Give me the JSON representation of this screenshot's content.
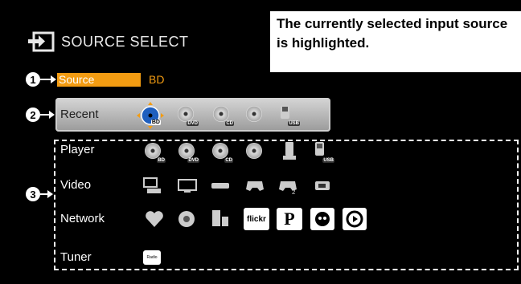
{
  "header": {
    "title": "SOURCE SELECT",
    "icon": "input-icon"
  },
  "callout": {
    "text": "The currently selected input source is highlighted."
  },
  "markers": {
    "one": "1",
    "two": "2",
    "three": "3"
  },
  "source": {
    "label": "Source",
    "value": "BD"
  },
  "recent": {
    "label": "Recent",
    "items": [
      "BD",
      "DVD",
      "CD",
      "",
      "USB"
    ]
  },
  "player": {
    "label": "Player",
    "items": [
      "BD",
      "DVD",
      "CD",
      "",
      "",
      "USB"
    ]
  },
  "video": {
    "label": "Video"
  },
  "network": {
    "label": "Network",
    "flickr": "flickr",
    "pandora": "P"
  },
  "tuner": {
    "label": "Tuner",
    "radio": "Radio"
  },
  "colors": {
    "accent": "#f39c12",
    "background": "#000000"
  }
}
